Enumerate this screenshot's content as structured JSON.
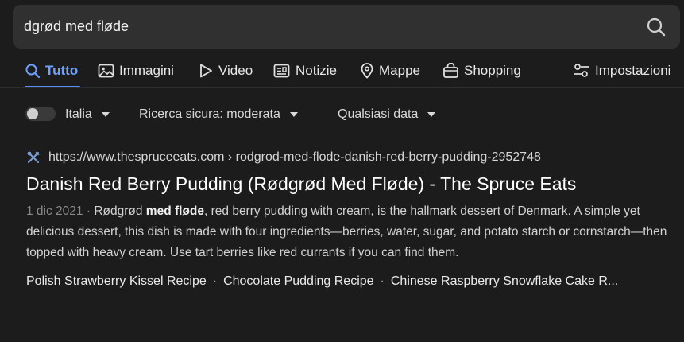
{
  "search": {
    "query": "dgrød med fløde"
  },
  "tabs": [
    {
      "label": "Tutto",
      "icon": "search-icon",
      "active": true
    },
    {
      "label": "Immagini",
      "icon": "image-icon"
    },
    {
      "label": "Video",
      "icon": "play-icon"
    },
    {
      "label": "Notizie",
      "icon": "newspaper-icon"
    },
    {
      "label": "Mappe",
      "icon": "map-pin-icon"
    },
    {
      "label": "Shopping",
      "icon": "shopping-bag-icon"
    }
  ],
  "settings": {
    "label": "Impostazioni",
    "icon": "sliders-icon"
  },
  "filters": {
    "region_toggle_on": false,
    "region": "Italia",
    "safe_search": "Ricerca sicura: moderata",
    "date": "Qualsiasi data"
  },
  "accent_color": "#6ea1ff",
  "result": {
    "favicon": "utensils-icon",
    "url": "https://www.thespruceeats.com › rodgrod-med-flode-danish-red-berry-pudding-2952748",
    "title": "Danish Red Berry Pudding (Rødgrød Med Fløde) - The Spruce Eats",
    "date": "1 dic 2021",
    "separator": "·",
    "snippet_part1": "Rødgrød",
    "snippet_bold": "med fløde",
    "snippet_part2": ", red berry pudding with cream, is the hallmark dessert of Denmark. A simple yet delicious dessert, this dish is made with four ingredients—berries, water, sugar, and potato starch or cornstarch—then topped with heavy cream. Use tart berries like red currants if you can find them.",
    "related_links": [
      "Polish Strawberry Kissel Recipe",
      "Chocolate Pudding Recipe",
      "Chinese Raspberry Snowflake Cake R..."
    ],
    "related_separator": "·"
  }
}
